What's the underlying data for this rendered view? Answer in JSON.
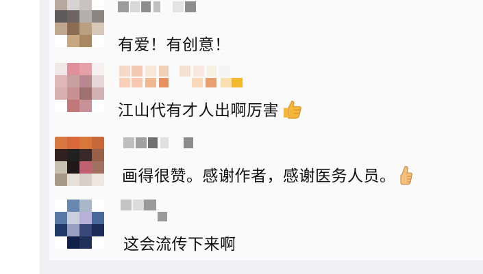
{
  "comments": [
    {
      "text": "有爱！有创意！",
      "avatar_colors": [
        "#b8a8a0",
        "#d8d2d2",
        "#c9c2c2",
        "#ffffff",
        "#5e5a5c",
        "#6e6466",
        "#b4aeae",
        "#8c8480",
        "#c0a890",
        "#8c6c52",
        "#b8a080",
        "#d8c8b8",
        "#ffffff",
        "#c8a880",
        "#a88860",
        "#ffffff"
      ]
    },
    {
      "text": "江山代有才人出啊厉害",
      "emoji": "thumbs-up-icon",
      "avatar_colors": [
        "#f0e8e8",
        "#e0909a",
        "#e8a0a8",
        "#f6f0f0",
        "#e0b8b8",
        "#c8a0a0",
        "#b88890",
        "#e6d8d8",
        "#d8b0b0",
        "#c89090",
        "#a07070",
        "#d0b0b0",
        "#ffffff",
        "#c07878",
        "#c89098",
        "#ffffff"
      ]
    },
    {
      "text": "画得很赞。感谢作者，感谢医务人员。",
      "emoji": "thumbs-up-icon",
      "avatar_colors": [
        "#d87840",
        "#d86838",
        "#d87838",
        "#c86838",
        "#302020",
        "#202020",
        "#382828",
        "#986048",
        "#c8c0b0",
        "#201818",
        "#c06070",
        "#a07060",
        "#a89888",
        "#e8e0d8",
        "#d8d0c8",
        "#f0e8e0"
      ]
    },
    {
      "text": "这会流传下来啊",
      "avatar_colors": [
        "#ffffff",
        "#6888b0",
        "#a8b8c8",
        "#ffffff",
        "#5878a8",
        "#c8d0e0",
        "#b8b0d8",
        "#486898",
        "#203868",
        "#98a0c0",
        "#384878",
        "#1c2c58",
        "#ffffff",
        "#102048",
        "#203058",
        "#ffffff"
      ]
    }
  ],
  "colors": {
    "background": "#ffffff",
    "frame": "#f1f1f3",
    "panel": "#fafafa",
    "text": "#111111",
    "emoji_fill": "#f4b73a"
  }
}
